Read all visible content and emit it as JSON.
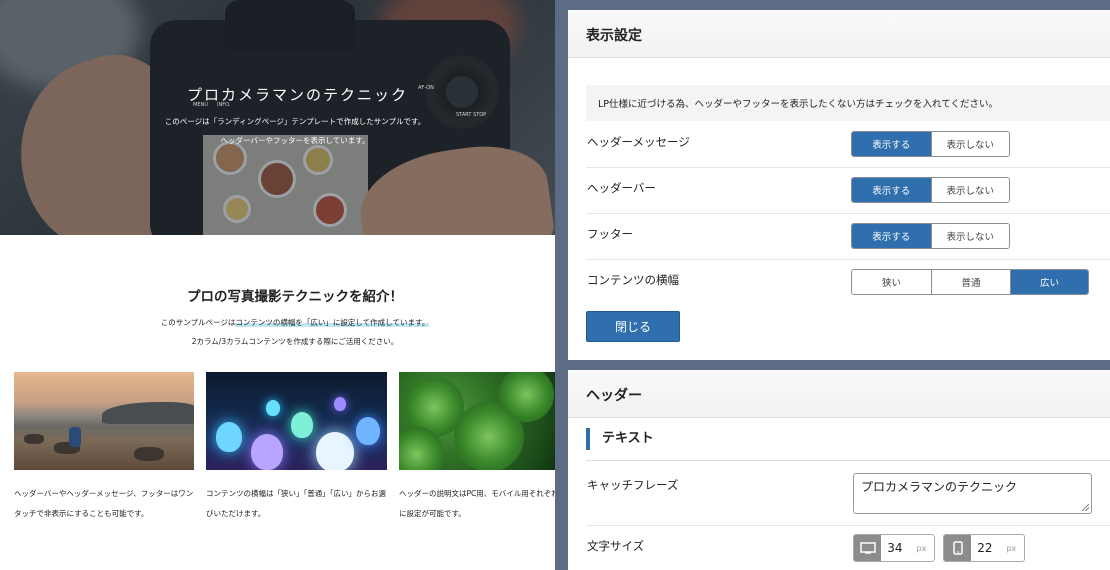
{
  "preview": {
    "hero": {
      "title": "プロカメラマンのテクニック",
      "subtitle_1": "このページは「ランディングページ」テンプレートで作成したサンプルです。",
      "subtitle_2": "ヘッダーバーやフッターを表示しています。",
      "camera_labels": [
        "MENU",
        "INFO.",
        "AF-ON",
        "START STOP"
      ]
    },
    "intro": {
      "title": "プロの写真撮影テクニックを紹介！",
      "line_1_pre": "このサンプルページは",
      "line_1_highlight": "コンテンツの横幅を「広い」に設定して作成しています。",
      "line_2": "2カラム/3カラムコンテンツを作成する際にご活用ください。"
    },
    "columns": [
      {
        "text": "ヘッダーバーやヘッダーメッセージ、フッターはワンタッチで非表示にすることも可能です。"
      },
      {
        "text": "コンテンツの横幅は「狭い」「普通」「広い」からお選びいただけます。"
      },
      {
        "text": "ヘッダーの説明文はPC用、モバイル用それぞれに設定が可能です。"
      }
    ]
  },
  "display_settings": {
    "title": "表示設定",
    "notice": "LP仕様に近づける為、ヘッダーやフッターを表示したくない方はチェックを入れてください。",
    "rows": [
      {
        "label": "ヘッダーメッセージ",
        "options": [
          "表示する",
          "表示しない"
        ],
        "selected": "表示する"
      },
      {
        "label": "ヘッダーバー",
        "options": [
          "表示する",
          "表示しない"
        ],
        "selected": "表示する"
      },
      {
        "label": "フッター",
        "options": [
          "表示する",
          "表示しない"
        ],
        "selected": "表示する"
      },
      {
        "label": "コンテンツの横幅",
        "options": [
          "狭い",
          "普通",
          "広い"
        ],
        "selected": "広い"
      }
    ],
    "close_label": "閉じる"
  },
  "header_settings": {
    "title": "ヘッダー",
    "section": "テキスト",
    "catchphrase_label": "キャッチフレーズ",
    "catchphrase_value": "プロカメラマンのテクニック",
    "font_size_label": "文字サイズ",
    "pc_size": "34",
    "mobile_size": "22",
    "unit": "px"
  },
  "colors": {
    "accent": "#2f6fae",
    "background": "#5d6b84"
  },
  "icons": [
    "desktop-icon",
    "mobile-icon"
  ]
}
